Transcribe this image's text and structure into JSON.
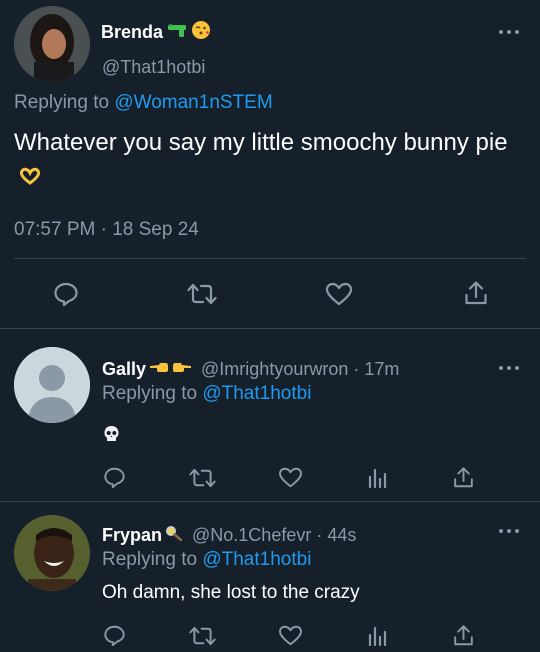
{
  "colors": {
    "background": "#15202b",
    "text": "#ffffff",
    "secondary": "#8b98a5",
    "link": "#1d9bf0",
    "divider": "#38444d"
  },
  "main_tweet": {
    "author_name": "Brenda",
    "author_emoji_1": "pistol-emoji",
    "author_emoji_2": "face-blowing-kiss-emoji",
    "handle": "@That1hotbi",
    "replying_prefix": "Replying to",
    "replying_to": "@Woman1nSTEM",
    "text": "Whatever you say my little smoochy bunny pie",
    "text_emoji": "heart-hands-emoji",
    "time": "07:57 PM",
    "separator": "·",
    "date": "18 Sep 24",
    "actions": [
      "reply-icon",
      "retweet-icon",
      "like-icon",
      "share-icon"
    ]
  },
  "replies": [
    {
      "author_name": "Gally",
      "author_emojis": [
        "backhand-index-pointing-left-emoji",
        "backhand-index-pointing-right-emoji"
      ],
      "handle": "@Imrightyourwron",
      "separator": "·",
      "time": "17m",
      "replying_prefix": "Replying to",
      "replying_to": "@That1hotbi",
      "text_emoji": "skull-emoji",
      "actions": [
        "reply-icon",
        "retweet-icon",
        "like-icon",
        "analytics-icon",
        "share-icon"
      ]
    },
    {
      "author_name": "Frypan",
      "author_emojis": [
        "frying-pan-emoji"
      ],
      "handle": "@No.1Chefevr",
      "separator": "·",
      "time": "44s",
      "replying_prefix": "Replying to",
      "replying_to": "@That1hotbi",
      "text": "Oh damn, she lost to the crazy",
      "actions": [
        "reply-icon",
        "retweet-icon",
        "like-icon",
        "analytics-icon",
        "share-icon"
      ]
    }
  ]
}
